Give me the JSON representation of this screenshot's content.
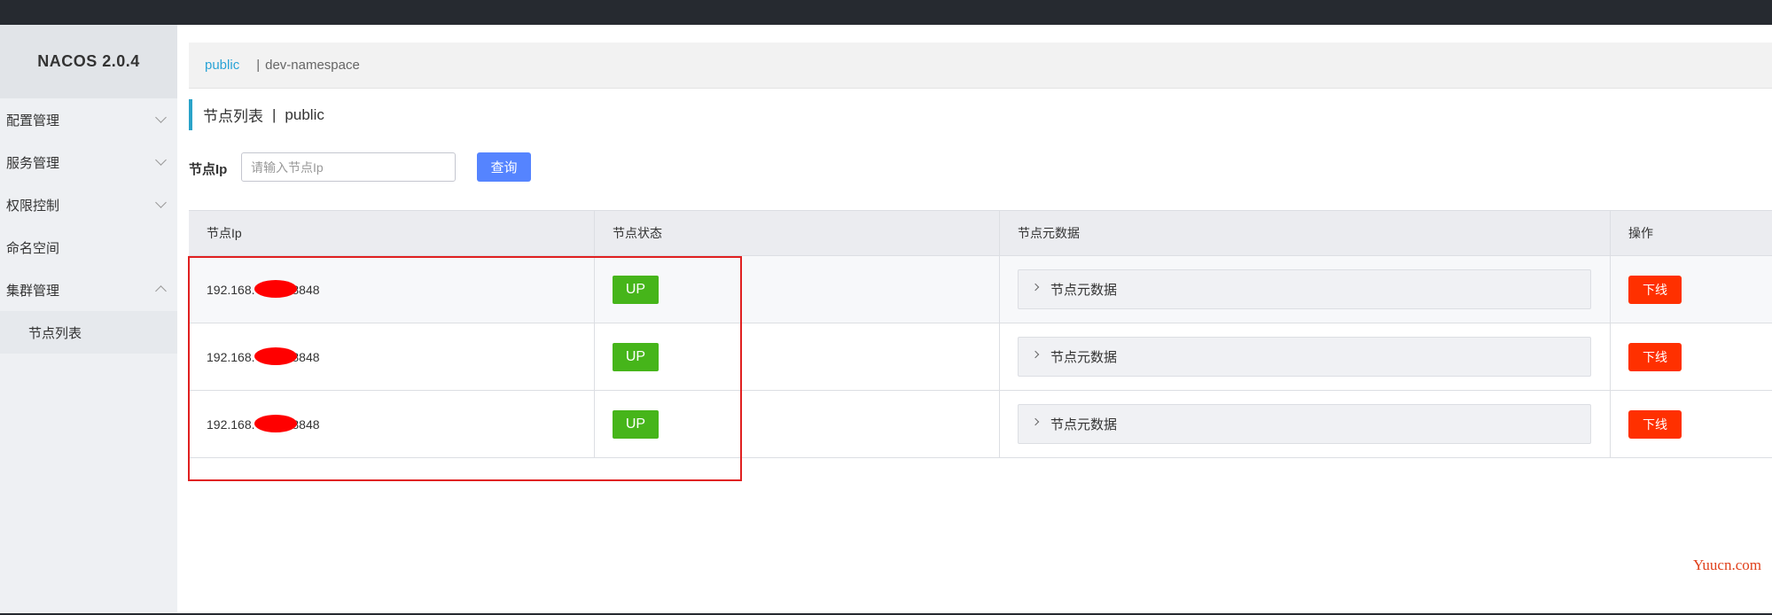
{
  "app": {
    "logo": "NACOS 2.0.4"
  },
  "sidebar": {
    "items": [
      {
        "label": "配置管理",
        "chevron": "down"
      },
      {
        "label": "服务管理",
        "chevron": "down"
      },
      {
        "label": "权限控制",
        "chevron": "down"
      },
      {
        "label": "命名空间",
        "chevron": "none"
      },
      {
        "label": "集群管理",
        "chevron": "up"
      }
    ],
    "sub_items": [
      {
        "label": "节点列表"
      }
    ]
  },
  "namespace_bar": {
    "active": "public",
    "separator": "|",
    "other": "dev-namespace"
  },
  "page_title": {
    "main": "节点列表",
    "separator": "|",
    "namespace": "public"
  },
  "search": {
    "label": "节点Ip",
    "placeholder": "请输入节点Ip",
    "value": "",
    "button": "查询"
  },
  "table": {
    "headers": [
      "节点Ip",
      "节点状态",
      "节点元数据",
      "操作"
    ],
    "rows": [
      {
        "ip_prefix": "192.168.",
        "ip_suffix": ":8848",
        "status": "UP",
        "metadata": "节点元数据",
        "action": "下线"
      },
      {
        "ip_prefix": "192.168.",
        "ip_suffix": ":8848",
        "status": "UP",
        "metadata": "节点元数据",
        "action": "下线"
      },
      {
        "ip_prefix": "192.168.",
        "ip_suffix": ":8848",
        "status": "UP",
        "metadata": "节点元数据",
        "action": "下线"
      }
    ]
  },
  "watermark": "Yuucn.com",
  "colors": {
    "topbar": "#262a30",
    "accent": "#2aa3d6",
    "primary_button": "#5584ff",
    "status_up": "#46b51a",
    "danger": "#ff3000",
    "annotation": "#e02020"
  }
}
